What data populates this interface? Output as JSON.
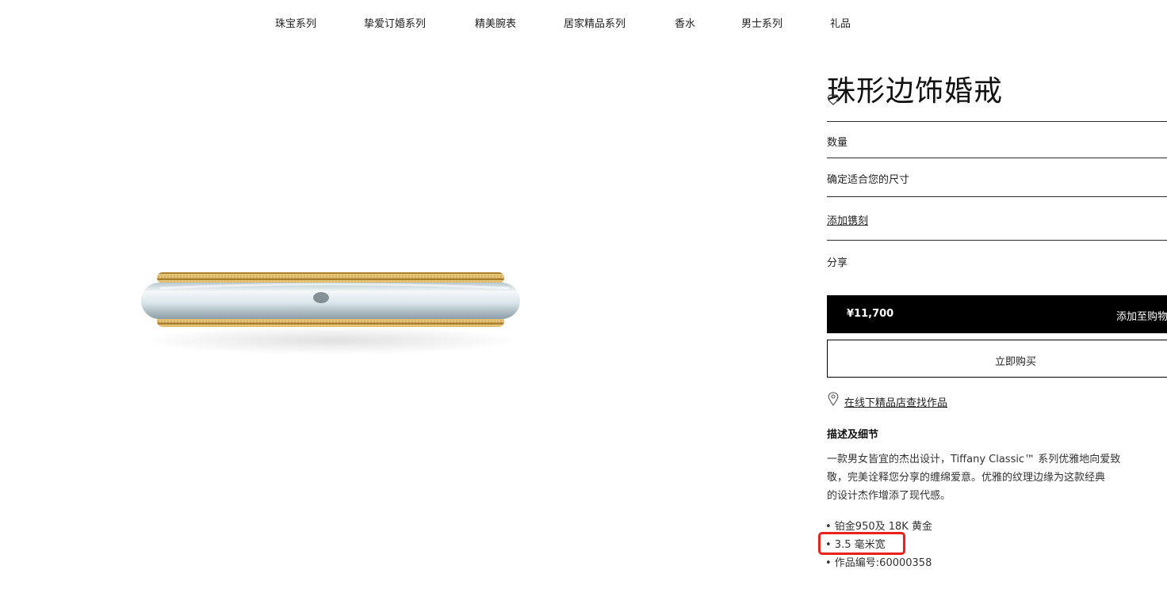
{
  "nav": {
    "items": [
      "珠宝系列",
      "挚爱订婚系列",
      "精美腕表",
      "居家精品系列",
      "香水",
      "男士系列",
      "礼品"
    ]
  },
  "product": {
    "title": "珠形边饰婚戒",
    "quantity_label": "数量",
    "size_label": "确定适合您的尺寸",
    "engraving_label": "添加镌刻",
    "share_label": "分享",
    "price": "¥11,700",
    "add_to_cart": "添加至购物",
    "buy_now": "立即购买",
    "store_link": "在线下精品店查找作品"
  },
  "description": {
    "heading": "描述及细节",
    "lines": [
      "一款男女皆宜的杰出设计，Tiffany Classic™ 系列优雅地向爱致",
      "敬，完美诠释您分享的缠绵爱意。优雅的纹理边缘为这款经典",
      "的设计杰作增添了现代感。"
    ],
    "specs": [
      "• 铂金950及 18K 黄金",
      "• 3.5 毫米宽",
      "• 作品编号:60000358"
    ]
  },
  "icons": {
    "favorite": "heart-outline-icon",
    "store": "map-pin-icon"
  },
  "colors": {
    "accent": "#000000",
    "highlight": "#e8221b",
    "gold": "#d9b15a",
    "platinum": "#dfe8ec"
  }
}
